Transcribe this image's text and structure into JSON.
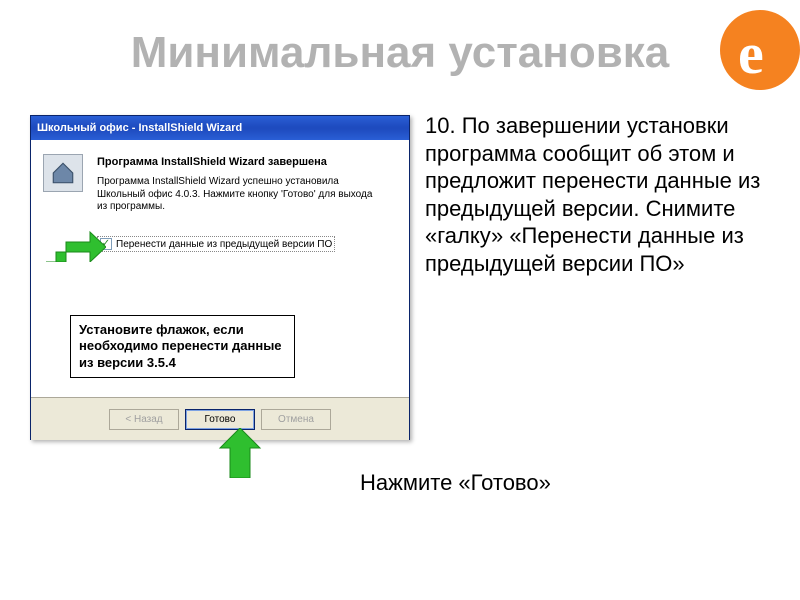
{
  "page_title": "Минимальная установка",
  "instruction_main": "10. По завершении установки программа сообщит об этом и предложит перенести данные из предыдущей версии. Снимите «галку» «Перенести данные из предыдущей версии ПО»",
  "instruction_click": "Нажмите «Готово»",
  "callout_text": "Установите флажок, если необходимо перенести данные из версии 3.5.4",
  "dialog": {
    "titlebar": "Школьный офис - InstallShield Wizard",
    "heading": "Программа InstallShield Wizard завершена",
    "body": "Программа InstallShield Wizard успешно установила Школьный офис 4.0.3. Нажмите кнопку 'Готово' для выхода из программы.",
    "checkbox_label": "Перенести данные из предыдущей версии ПО",
    "checkbox_checked": "✓",
    "buttons": {
      "back": "< Назад",
      "finish": "Готово",
      "cancel": "Отмена"
    }
  }
}
